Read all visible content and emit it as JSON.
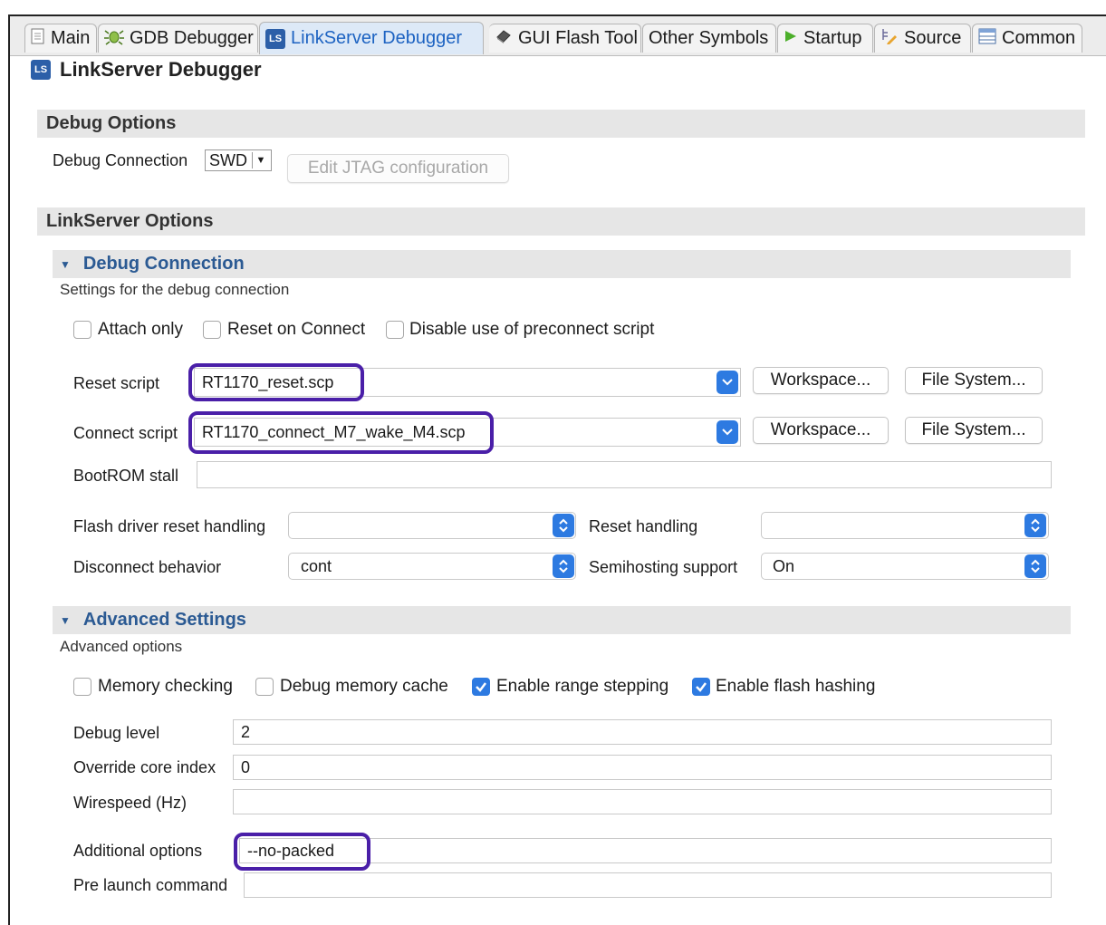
{
  "tabs": [
    {
      "label": "Main",
      "icon": "page-icon"
    },
    {
      "label": "GDB Debugger",
      "icon": "bug-icon"
    },
    {
      "label": "LinkServer Debugger",
      "icon": "ls-icon"
    },
    {
      "label": "GUI Flash Tool",
      "icon": "chip-icon"
    },
    {
      "label": "Other Symbols",
      "icon": ""
    },
    {
      "label": "Startup",
      "icon": "play-icon"
    },
    {
      "label": "Source",
      "icon": "source-icon"
    },
    {
      "label": "Common",
      "icon": "table-icon"
    }
  ],
  "ls_badge": "LS",
  "page_title": "LinkServer Debugger",
  "debug_options": {
    "header": "Debug Options",
    "connection_label": "Debug Connection",
    "connection_value": "SWD",
    "edit_jtag": "Edit JTAG configuration"
  },
  "linkserver_options": {
    "header": "LinkServer Options"
  },
  "debug_connection": {
    "header": "Debug Connection",
    "description": "Settings for the debug connection",
    "checkboxes": [
      {
        "label": "Attach only",
        "checked": false
      },
      {
        "label": "Reset on Connect",
        "checked": false
      },
      {
        "label": "Disable use of preconnect script",
        "checked": false
      }
    ],
    "reset_script_label": "Reset script",
    "reset_script_value": "RT1170_reset.scp",
    "connect_script_label": "Connect script",
    "connect_script_value": "RT1170_connect_M7_wake_M4.scp",
    "workspace_btn": "Workspace...",
    "filesystem_btn": "File System...",
    "bootrom_label": "BootROM stall",
    "bootrom_value": "",
    "flash_reset_label": "Flash driver reset handling",
    "flash_reset_value": "",
    "reset_handling_label": "Reset handling",
    "reset_handling_value": "",
    "disconnect_label": "Disconnect behavior",
    "disconnect_value": "cont",
    "semihosting_label": "Semihosting support",
    "semihosting_value": "On"
  },
  "advanced": {
    "header": "Advanced Settings",
    "description": "Advanced options",
    "checkboxes": [
      {
        "label": "Memory checking",
        "checked": false
      },
      {
        "label": "Debug memory cache",
        "checked": false
      },
      {
        "label": "Enable range stepping",
        "checked": true
      },
      {
        "label": "Enable flash hashing",
        "checked": true
      }
    ],
    "debug_level_label": "Debug level",
    "debug_level_value": "2",
    "core_index_label": "Override core index",
    "core_index_value": "0",
    "wirespeed_label": "Wirespeed (Hz)",
    "wirespeed_value": "",
    "additional_label": "Additional options",
    "additional_value": "--no-packed",
    "prelaunch_label": "Pre launch command",
    "prelaunch_value": ""
  },
  "colors": {
    "accent": "#2d7ae1",
    "highlight": "#4a1fa8",
    "section_bg": "#e6e6e6"
  }
}
